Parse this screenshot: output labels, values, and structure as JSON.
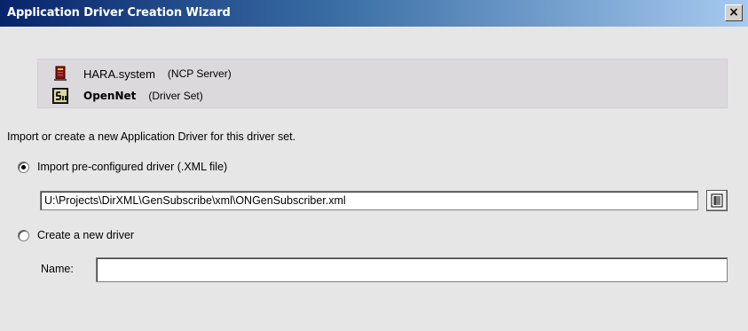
{
  "window": {
    "title": "Application Driver Creation Wizard",
    "close_label": "×"
  },
  "context": {
    "server": {
      "name": "HARA.system",
      "type": "(NCP Server)",
      "icon": "server-icon"
    },
    "driver_set": {
      "name": "OpenNet",
      "type": "(Driver Set)",
      "icon": "driver-set-icon"
    }
  },
  "intro_text": "Import or create a new Application Driver for this driver set.",
  "options": {
    "import": {
      "label": "Import pre-configured driver (.XML file)",
      "selected": true
    },
    "create": {
      "label": "Create a new driver",
      "selected": false
    }
  },
  "file_path": {
    "value": "U:\\Projects\\DirXML\\GenSubscribe\\xml\\ONGenSubscriber.xml",
    "browse_icon": "browse-icon"
  },
  "name_field": {
    "label": "Name:",
    "value": ""
  },
  "colors": {
    "titlebar_start": "#08246b",
    "titlebar_end": "#a6caf0",
    "dialog_background": "#e6e6e6",
    "info_panel_background": "#dcd9dc"
  }
}
